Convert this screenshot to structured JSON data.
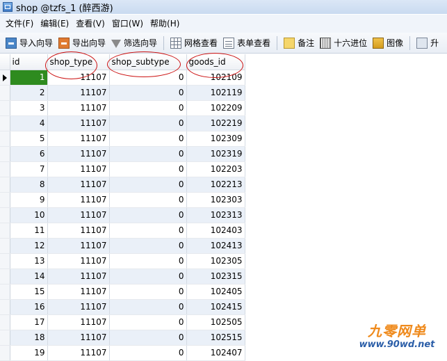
{
  "window": {
    "title": "shop @tzfs_1 (醉西游)"
  },
  "menu": [
    "文件(F)",
    "编辑(E)",
    "查看(V)",
    "窗口(W)",
    "帮助(H)"
  ],
  "toolbar": {
    "import": "导入向导",
    "export": "导出向导",
    "filter": "筛选向导",
    "grid_view": "网格查看",
    "form_view": "表单查看",
    "memo": "备注",
    "hex": "十六进位",
    "image": "图像",
    "overflow": "升"
  },
  "table": {
    "columns": [
      "id",
      "shop_type",
      "shop_subtype",
      "goods_id"
    ],
    "rows": [
      {
        "id": "1",
        "shop_type": "11107",
        "shop_subtype": "0",
        "goods_id": "102109"
      },
      {
        "id": "2",
        "shop_type": "11107",
        "shop_subtype": "0",
        "goods_id": "102119"
      },
      {
        "id": "3",
        "shop_type": "11107",
        "shop_subtype": "0",
        "goods_id": "102209"
      },
      {
        "id": "4",
        "shop_type": "11107",
        "shop_subtype": "0",
        "goods_id": "102219"
      },
      {
        "id": "5",
        "shop_type": "11107",
        "shop_subtype": "0",
        "goods_id": "102309"
      },
      {
        "id": "6",
        "shop_type": "11107",
        "shop_subtype": "0",
        "goods_id": "102319"
      },
      {
        "id": "7",
        "shop_type": "11107",
        "shop_subtype": "0",
        "goods_id": "102203"
      },
      {
        "id": "8",
        "shop_type": "11107",
        "shop_subtype": "0",
        "goods_id": "102213"
      },
      {
        "id": "9",
        "shop_type": "11107",
        "shop_subtype": "0",
        "goods_id": "102303"
      },
      {
        "id": "10",
        "shop_type": "11107",
        "shop_subtype": "0",
        "goods_id": "102313"
      },
      {
        "id": "11",
        "shop_type": "11107",
        "shop_subtype": "0",
        "goods_id": "102403"
      },
      {
        "id": "12",
        "shop_type": "11107",
        "shop_subtype": "0",
        "goods_id": "102413"
      },
      {
        "id": "13",
        "shop_type": "11107",
        "shop_subtype": "0",
        "goods_id": "102305"
      },
      {
        "id": "14",
        "shop_type": "11107",
        "shop_subtype": "0",
        "goods_id": "102315"
      },
      {
        "id": "15",
        "shop_type": "11107",
        "shop_subtype": "0",
        "goods_id": "102405"
      },
      {
        "id": "16",
        "shop_type": "11107",
        "shop_subtype": "0",
        "goods_id": "102415"
      },
      {
        "id": "17",
        "shop_type": "11107",
        "shop_subtype": "0",
        "goods_id": "102505"
      },
      {
        "id": "18",
        "shop_type": "11107",
        "shop_subtype": "0",
        "goods_id": "102515"
      },
      {
        "id": "19",
        "shop_type": "11107",
        "shop_subtype": "0",
        "goods_id": "102407"
      }
    ]
  },
  "watermark": {
    "name": "九零网单",
    "url": "www.90wd.net"
  },
  "colors": {
    "selected_cell": "#2e8b1f",
    "alt_row": "#eaf0f8",
    "annotation": "#cc1010"
  }
}
